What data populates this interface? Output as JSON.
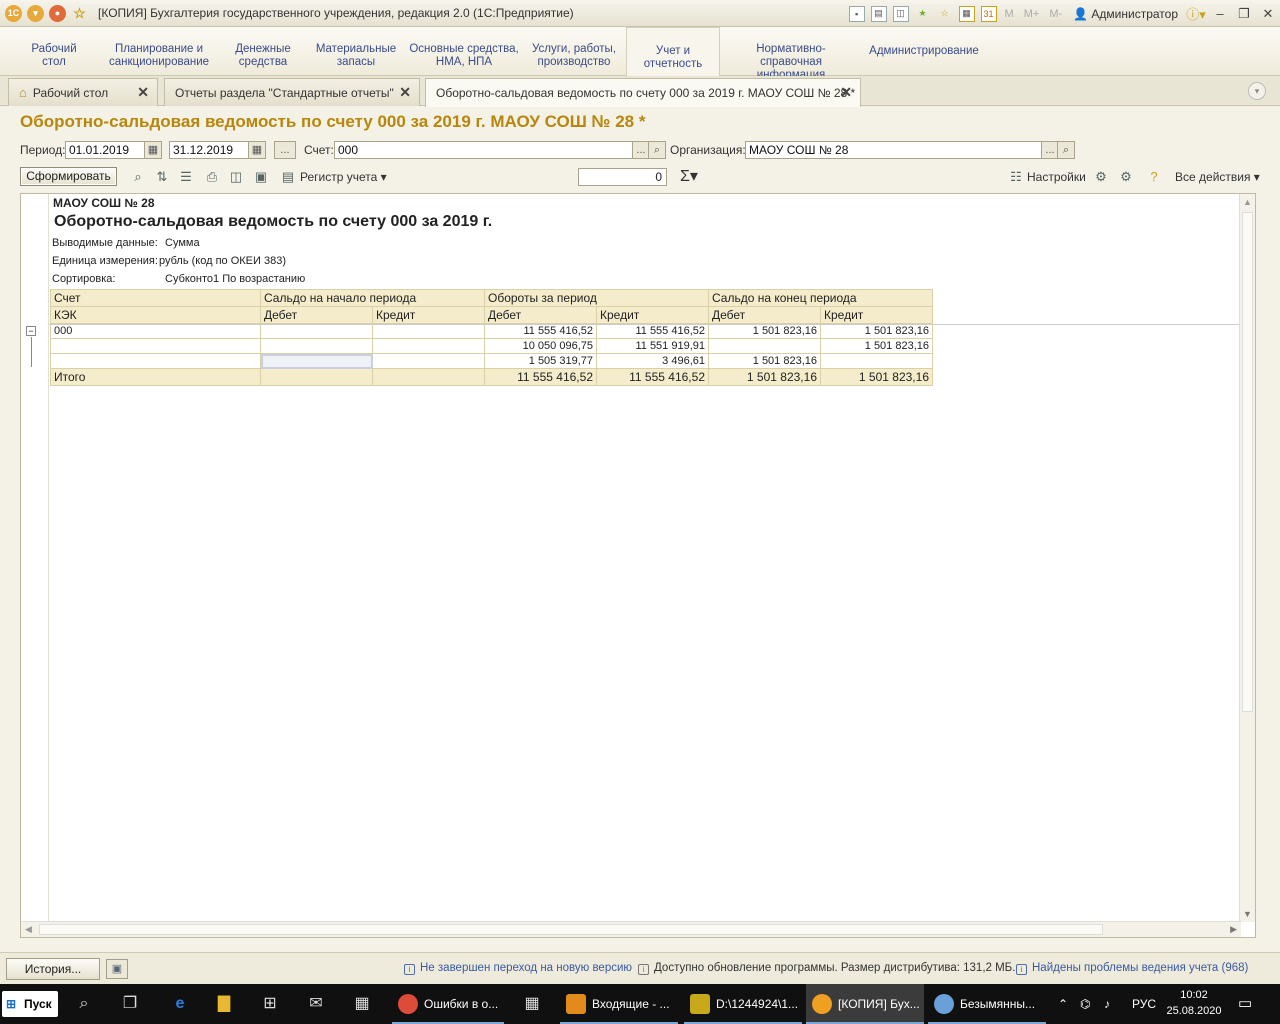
{
  "window": {
    "title": "[КОПИЯ] Бухгалтерия государственного учреждения, редакция 2.0  (1С:Предприятие)",
    "user": "Администратор",
    "m_labels": [
      "M",
      "M+",
      "M-"
    ]
  },
  "sections": [
    {
      "label": "Рабочий\nстол"
    },
    {
      "label": "Планирование и\nсанкционирование"
    },
    {
      "label": "Денежные\nсредства"
    },
    {
      "label": "Материальные\nзапасы"
    },
    {
      "label": "Основные средства,\nНМА, НПА"
    },
    {
      "label": "Услуги, работы,\nпроизводство"
    },
    {
      "label": "Учет и\nотчетность"
    },
    {
      "label": "Нормативно-справочная\nинформация"
    },
    {
      "label": "Администрирование"
    }
  ],
  "tabs": [
    {
      "label": "Рабочий стол"
    },
    {
      "label": "Отчеты раздела \"Стандартные отчеты\""
    },
    {
      "label": "Оборотно-сальдовая ведомость по счету 000 за 2019 г. МАОУ СОШ № 28 *"
    }
  ],
  "doc": {
    "title": "Оборотно-сальдовая ведомость по счету 000 за 2019 г. МАОУ СОШ № 28 *"
  },
  "filters": {
    "period_label": "Период:",
    "date_from": "01.01.2019",
    "date_to": "31.12.2019",
    "dots": "...",
    "account_label": "Счет:",
    "account_value": "000",
    "org_label": "Организация:",
    "org_value": "МАОУ СОШ № 28"
  },
  "toolbar": {
    "generate": "Сформировать",
    "register": "Регистр учета",
    "sum_value": "0",
    "settings": "Настройки",
    "all_actions": "Все действия"
  },
  "report": {
    "org": "МАОУ СОШ № 28",
    "title": "Оборотно-сальдовая ведомость по счету 000 за 2019 г.",
    "output_label": "Выводимые данные:",
    "output_value": "Сумма",
    "unit_label": "Единица измерения:",
    "unit_value": "рубль (код по ОКЕИ 383)",
    "sort_label": "Сортировка:",
    "sort_value": "Субконто1 По возрастанию",
    "header1": [
      "Счет",
      "Сальдо на начало периода",
      "Обороты за период",
      "Сальдо на конец периода"
    ],
    "header2": [
      "КЭК",
      "Дебет",
      "Кредит",
      "Дебет",
      "Кредит",
      "Дебет",
      "Кредит"
    ],
    "rows": [
      [
        "000",
        "",
        "",
        "11 555 416,52",
        "11 555 416,52",
        "1 501 823,16",
        "1 501 823,16"
      ],
      [
        "",
        "",
        "",
        "10 050 096,75",
        "11 551 919,91",
        "",
        "1 501 823,16"
      ],
      [
        "",
        "",
        "",
        "1 505 319,77",
        "3 496,61",
        "1 501 823,16",
        ""
      ]
    ],
    "total": [
      "Итого",
      "",
      "",
      "11 555 416,52",
      "11 555 416,52",
      "1 501 823,16",
      "1 501 823,16"
    ]
  },
  "status": {
    "history": "История...",
    "msg1": "Не завершен переход на новую версию",
    "msg2": "Доступно обновление программы. Размер дистрибутива: 131,2 МБ.",
    "msg3": "Найдены проблемы ведения учета (968)"
  },
  "taskbar": {
    "start": "Пуск",
    "apps": [
      {
        "label": "Ошибки в о...",
        "color": "#dd4b39"
      },
      {
        "label": "Входящие - ...",
        "color": "#e38b1a"
      },
      {
        "label": "D:\\1244924\\1...",
        "color": "#c7a91a"
      },
      {
        "label": "[КОПИЯ] Бух...",
        "color": "#f0a020"
      },
      {
        "label": "Безымянны...",
        "color": "#6aa0d8"
      }
    ],
    "lang": "РУС",
    "time": "10:02",
    "date": "25.08.2020"
  }
}
